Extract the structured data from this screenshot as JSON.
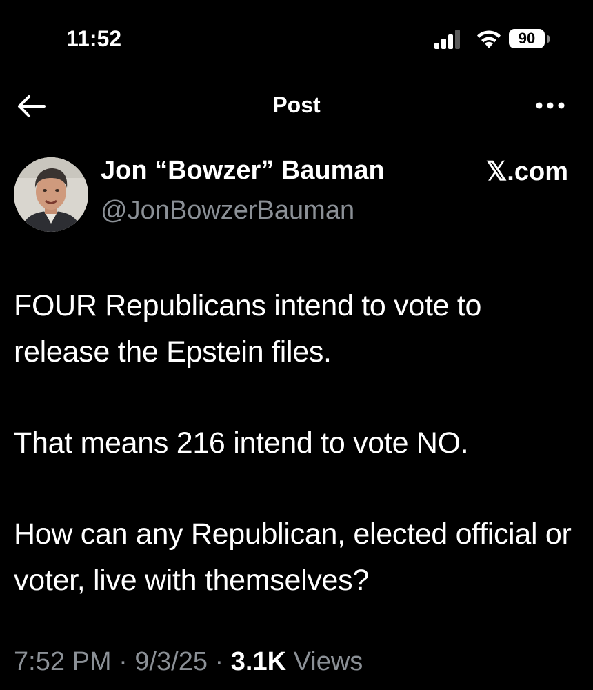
{
  "status_bar": {
    "time": "11:52",
    "battery": "90",
    "icons": [
      "signal-icon",
      "wifi-icon",
      "battery-icon"
    ]
  },
  "header": {
    "title": "Post",
    "back_icon": "back-arrow-icon",
    "more_icon": "more-options-icon"
  },
  "author": {
    "name": "Jon “Bowzer” Bauman",
    "handle": "@JonBowzerBauman",
    "watermark": "𝕏.com"
  },
  "post": {
    "paragraphs": [
      "FOUR Republicans intend to vote to release the Epstein files.",
      "That means 216 intend to vote NO.",
      "How can any Republican, elected official or voter, live with themselves?"
    ]
  },
  "meta": {
    "time": "7:52 PM",
    "separator": " · ",
    "date": "9/3/25",
    "views_count": "3.1K",
    "views_label": "Views"
  },
  "colors": {
    "background": "#000000",
    "text_primary": "#ffffff",
    "text_secondary": "#8b9096"
  }
}
